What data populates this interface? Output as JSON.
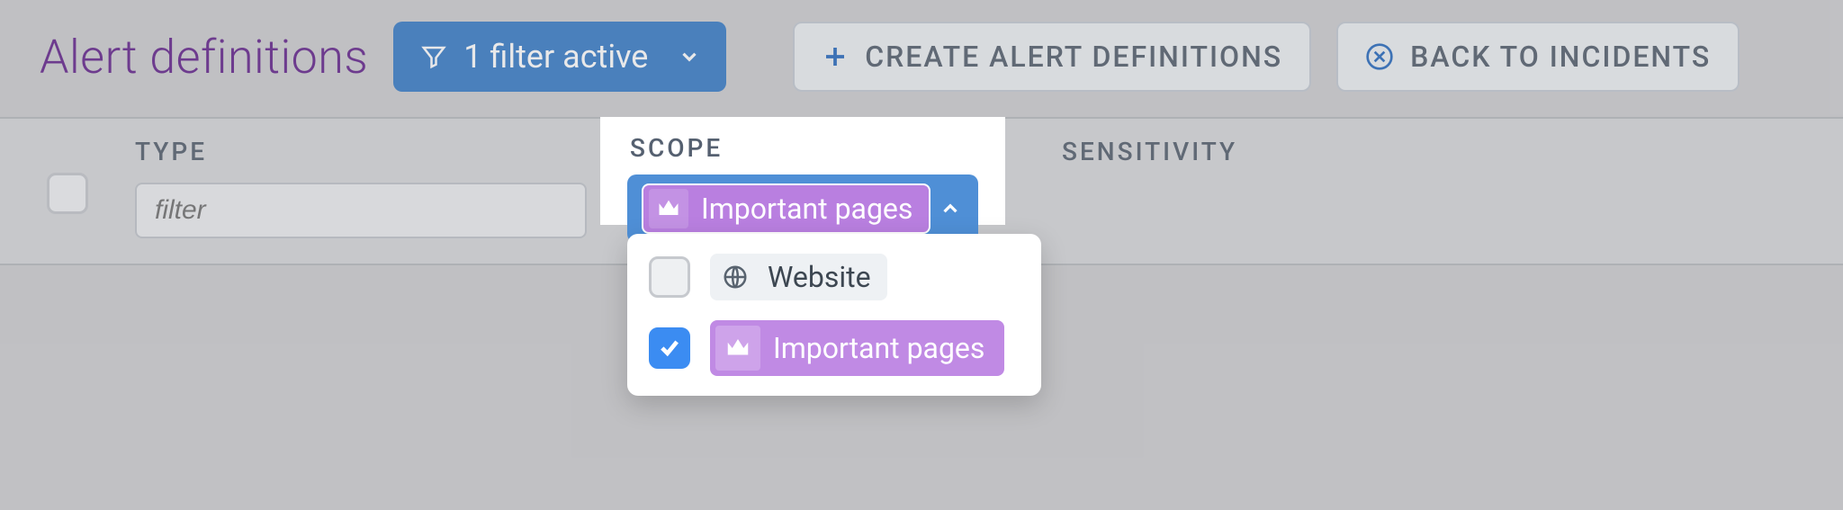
{
  "header": {
    "title": "Alert definitions",
    "filter_button": "1 filter active",
    "create_button": "Create Alert Definitions",
    "back_button": "Back to Incidents"
  },
  "table": {
    "columns": {
      "type": "Type",
      "scope": "Scope",
      "sensitivity": "Sensitivity"
    },
    "type_filter_placeholder": "filter"
  },
  "scope_filter": {
    "selected_tag": "Important pages",
    "options": [
      {
        "label": "Website",
        "icon": "globe",
        "checked": false
      },
      {
        "label": "Important pages",
        "icon": "crown",
        "checked": true
      }
    ]
  },
  "colors": {
    "primary": "#3f81c9",
    "accent_purple": "#6a2d91",
    "tag_purple": "#b97fe0"
  }
}
